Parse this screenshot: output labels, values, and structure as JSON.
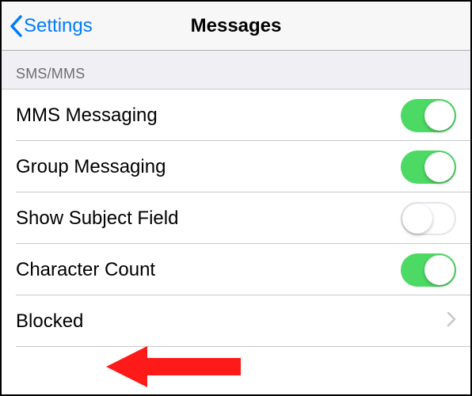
{
  "header": {
    "back_label": "Settings",
    "title": "Messages"
  },
  "section": {
    "label": "SMS/MMS"
  },
  "rows": {
    "mms": {
      "label": "MMS Messaging",
      "on": true
    },
    "group": {
      "label": "Group Messaging",
      "on": true
    },
    "subject": {
      "label": "Show Subject Field",
      "on": false
    },
    "charcount": {
      "label": "Character Count",
      "on": true
    },
    "blocked": {
      "label": "Blocked"
    }
  },
  "colors": {
    "accent": "#007aff",
    "toggle_on": "#4cd964",
    "annotation": "#ff1a1a"
  }
}
